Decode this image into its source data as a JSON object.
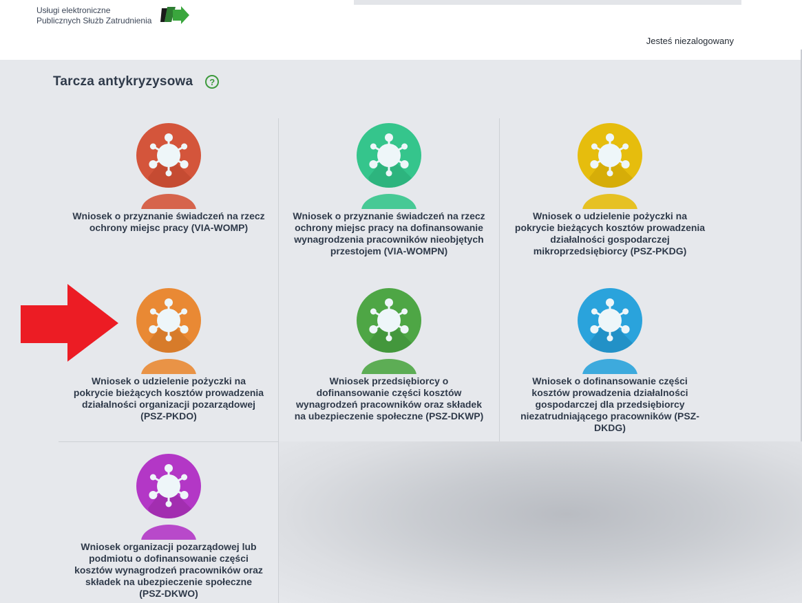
{
  "header": {
    "logo_line1": "Usługi elektroniczne",
    "logo_line2": "Publicznych Służb Zatrudnienia",
    "login_status": "Jesteś niezalogowany"
  },
  "page": {
    "title": "Tarcza antykryzysowa",
    "help_symbol": "?"
  },
  "tiles": [
    {
      "label": "Wniosek o przyznanie świadczeń na rzecz ochrony miejsc pracy (VIA-WOMP)",
      "color": "#d4553b",
      "dark": "#b8442c"
    },
    {
      "label": "Wniosek o przyznanie świadczeń na rzecz ochrony miejsc pracy na dofinansowanie wynagrodzenia pracowników nieobjętych przestojem (VIA-WOMPN)",
      "color": "#35c58c",
      "dark": "#26a673"
    },
    {
      "label": "Wniosek o udzielenie pożyczki na pokrycie bieżących kosztów prowadzenia działalności gospodarczej mikroprzedsiębiorcy (PSZ-PKDG)",
      "color": "#e6bd0d",
      "dark": "#c8a106"
    },
    {
      "label": "Wniosek o udzielenie pożyczki na pokrycie bieżących kosztów prowadzenia działalności organizacji pozarządowej (PSZ-PKDO)",
      "color": "#e98934",
      "dark": "#c96f22"
    },
    {
      "label": "Wniosek przedsiębiorcy o dofinansowanie części kosztów wynagrodzeń pracowników oraz składek na ubezpieczenie społeczne (PSZ-DKWP)",
      "color": "#4ea645",
      "dark": "#3a8a34"
    },
    {
      "label": "Wniosek o dofinansowanie części kosztów prowadzenia działalności gospodarczej dla przedsiębiorcy niezatrudniającego pracowników (PSZ-DKDG)",
      "color": "#2aa3dc",
      "dark": "#1c84b6"
    },
    {
      "label": "Wniosek organizacji pozarządowej lub podmiotu o dofinansowanie części kosztów wynagrodzeń pracowników oraz składek na ubezpieczenie społeczne (PSZ-DKWO)",
      "color": "#b337c6",
      "dark": "#94289f"
    }
  ],
  "icons": {
    "tile_icon": "virus-icon",
    "help": "question-circle-icon",
    "annotation": "red-arrow-annotation"
  },
  "colors": {
    "background": "#e6e8ec",
    "accent_green": "#3d9a3d",
    "arrow_red": "#ec1c24"
  }
}
